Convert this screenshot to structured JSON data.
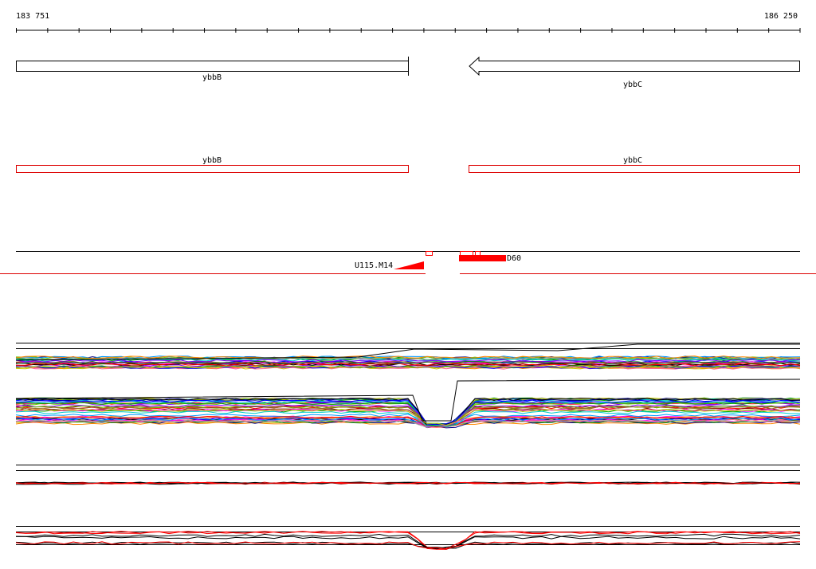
{
  "ruler": {
    "start_label": "183 751",
    "end_label": "186 250"
  },
  "colors": {
    "gene_outline": "#000000",
    "cds_outline": "#dd0000",
    "feature_fill": "#ff0000"
  },
  "genes": [
    {
      "name": "ybbB",
      "direction": "forward"
    },
    {
      "name": "ybbC",
      "direction": "reverse"
    }
  ],
  "cds": [
    {
      "name": "ybbB"
    },
    {
      "name": "ybbC"
    }
  ],
  "features": [
    {
      "label": "U115.M14"
    },
    {
      "label": "D60"
    }
  ],
  "tracks": [
    {
      "type": "multi-line expression profiles",
      "count": "many",
      "dip": "between ybbB and ybbC"
    },
    {
      "type": "flat profiles (black/red)"
    },
    {
      "type": "profiles with dip (black/red)"
    }
  ]
}
